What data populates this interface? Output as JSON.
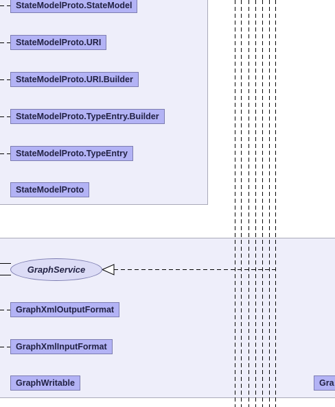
{
  "packages": [
    {
      "classes": [
        "StateModelProto.StateModel",
        "StateModelProto.URI",
        "StateModelProto.URI.Builder",
        "StateModelProto.TypeEntry.Builder",
        "StateModelProto.TypeEntry",
        "StateModelProto"
      ]
    },
    {
      "interface": "GraphService",
      "classes": [
        "GraphXmlOutputFormat",
        "GraphXmlInputFormat",
        "GraphWritable"
      ],
      "clipped_class": "Gra"
    }
  ]
}
